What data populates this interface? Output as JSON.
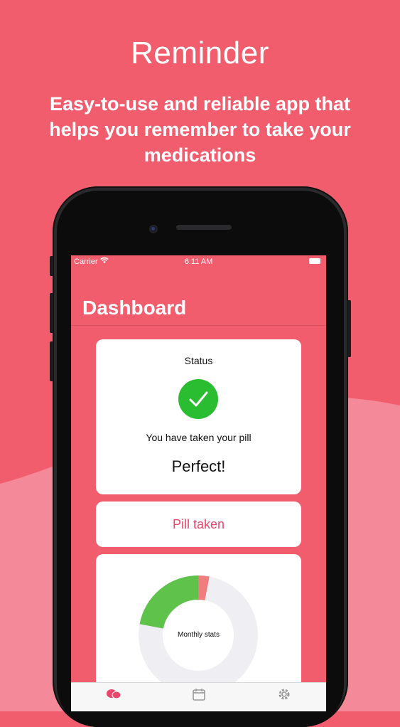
{
  "promo": {
    "title": "Reminder",
    "subtitle": "Easy-to-use and reliable app that helps you remember to take your medications"
  },
  "statusbar": {
    "carrier": "Carrier",
    "time": "6:11 AM"
  },
  "dashboard": {
    "title": "Dashboard",
    "status_label": "Status",
    "status_message": "You have taken your pill",
    "status_result": "Perfect!",
    "pill_button": "Pill taken",
    "stats_label": "Monthly stats",
    "stats": {
      "taken_fraction": 0.22,
      "missed_fraction": 0.03
    }
  },
  "tabs": [
    {
      "icon": "pills-icon"
    },
    {
      "icon": "calendar-icon"
    },
    {
      "icon": "gear-icon"
    }
  ],
  "colors": {
    "background": "#f25d6e",
    "accent": "#e8466a",
    "success": "#2bbd31",
    "taken": "#5ec24b",
    "missed": "#ef7f7f"
  }
}
